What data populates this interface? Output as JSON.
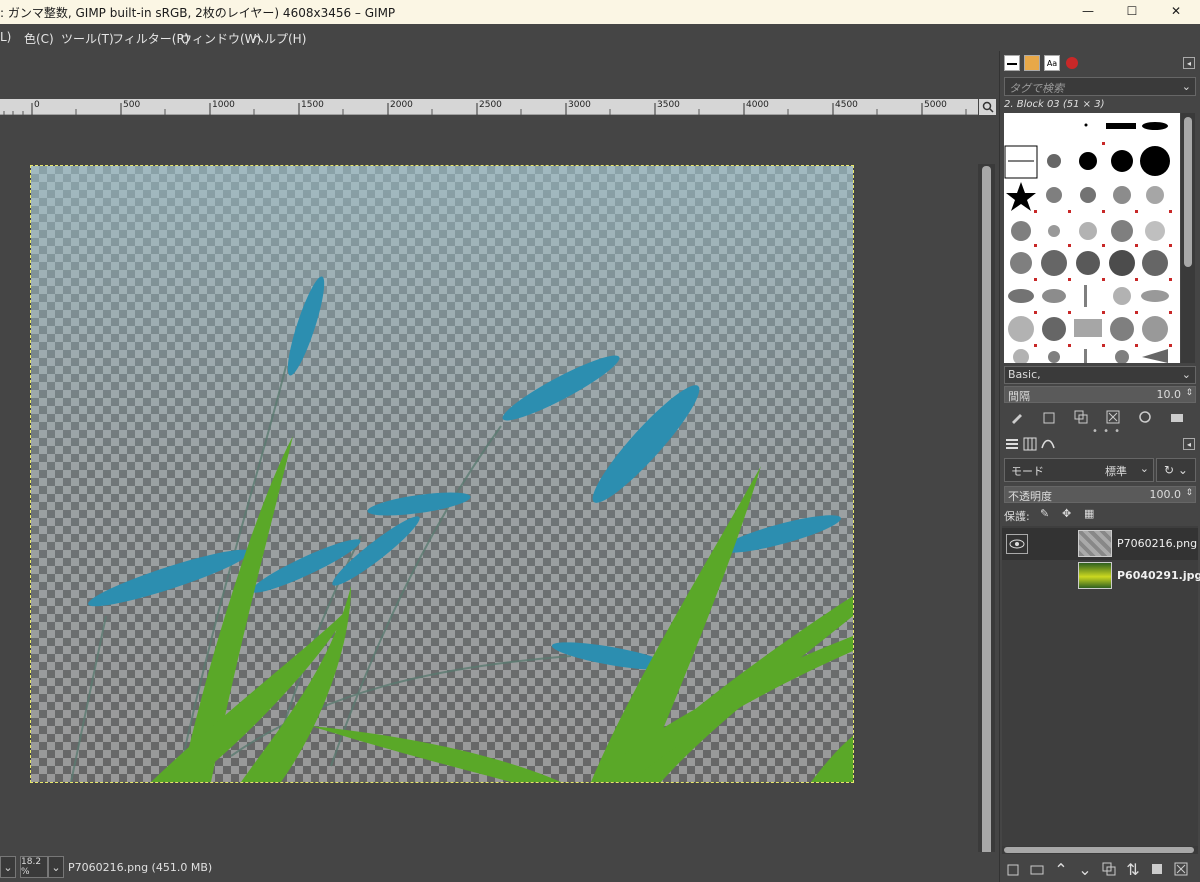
{
  "window": {
    "title": ": ガンマ整数, GIMP built-in sRGB, 2枚のレイヤー) 4608x3456 – GIMP",
    "minimize": "—",
    "maximize": "☐",
    "close": "✕"
  },
  "menu": {
    "items": [
      "L)",
      "色(C)",
      "ツール(T)",
      "フィルター(R)",
      "ウィンドウ(W)",
      "ヘルプ(H)"
    ]
  },
  "ruler": {
    "labels": [
      "0",
      "500",
      "1000",
      "1500",
      "2000",
      "2500",
      "3000",
      "3500",
      "4000",
      "4500",
      "5000"
    ]
  },
  "statusbar": {
    "zoom": "18.2 %",
    "file_info": "P7060216.png (451.0 MB)"
  },
  "brushes": {
    "tag_placeholder": "タグで検索",
    "selected_brush": "2. Block 03 (51 × 3)",
    "preset": "Basic,",
    "spacing_label": "間隔",
    "spacing_value": "10.0"
  },
  "layers": {
    "mode_label": "モード",
    "mode_value": "標準",
    "opacity_label": "不透明度",
    "opacity_value": "100.0",
    "lock_label": "保護:",
    "items": [
      {
        "name": "P7060216.png",
        "bold": false
      },
      {
        "name": "P6040291.jpg",
        "bold": true
      }
    ]
  },
  "colors": {
    "accent_stalk": "#2c8eb0",
    "leaf": "#5aa828",
    "selection": "#e8e86c"
  }
}
